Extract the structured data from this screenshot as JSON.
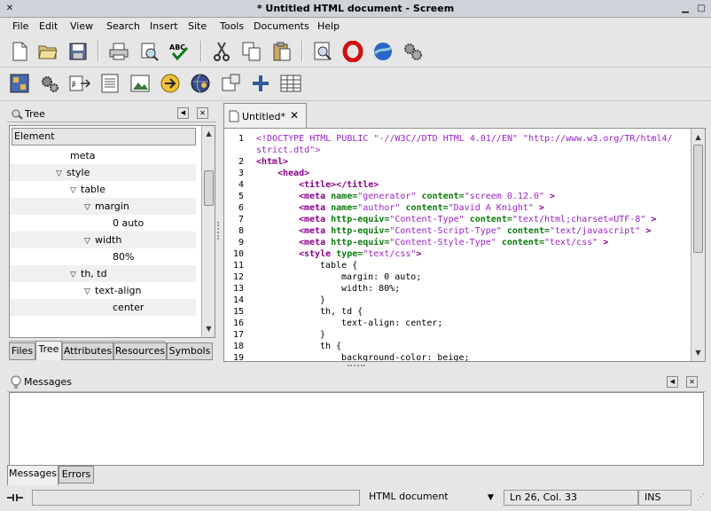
{
  "window": {
    "title": "* Untitled HTML document - Screem"
  },
  "menubar": [
    "File",
    "Edit",
    "View",
    "Search",
    "Insert",
    "Site",
    "Tools",
    "Documents",
    "Help"
  ],
  "toolbar1": [
    "new-document-icon",
    "open-folder-icon",
    "save-icon",
    "print-icon",
    "print-preview-icon",
    "spell-check-icon",
    "cut-icon",
    "copy-icon",
    "paste-icon",
    "preview-icon",
    "opera-icon",
    "mozilla-icon",
    "gears-icon"
  ],
  "toolbar2": [
    "site-icon",
    "settings-gears-icon",
    "export-icon",
    "text-icon",
    "image-icon",
    "link-arrow-icon",
    "globe-icon",
    "plugin-icon",
    "add-plus-icon",
    "table-icon"
  ],
  "tree": {
    "title": "Tree",
    "header": "Element",
    "nodes": [
      {
        "label": "meta",
        "expanded": null
      },
      {
        "label": "style",
        "expanded": true
      },
      {
        "label": "table",
        "expanded": true
      },
      {
        "label": "margin",
        "expanded": true
      },
      {
        "label": "0 auto",
        "expanded": null
      },
      {
        "label": "width",
        "expanded": true
      },
      {
        "label": "80%",
        "expanded": null
      },
      {
        "label": "th, td",
        "expanded": true
      },
      {
        "label": "text-align",
        "expanded": true
      },
      {
        "label": "center",
        "expanded": null
      }
    ],
    "tabs": [
      "Files",
      "Tree",
      "Attributes",
      "Resources",
      "Symbols"
    ],
    "active_tab": "Tree"
  },
  "editor": {
    "tab_label": "Untitled*",
    "line_numbers": [
      "1",
      "",
      "2",
      "3",
      "4",
      "5",
      "6",
      "7",
      "8",
      "9",
      "10",
      "11",
      "12",
      "13",
      "14",
      "15",
      "16",
      "17",
      "18",
      "19"
    ]
  },
  "messages": {
    "title": "Messages",
    "tabs": [
      "Messages",
      "Errors"
    ],
    "active_tab": "Messages"
  },
  "status": {
    "doc_type": "HTML document",
    "position": "Ln 26, Col. 33",
    "mode": "INS"
  },
  "colors": {
    "tag": "#8b008b",
    "attr_name": "#0b7a0b",
    "attr_value": "#9b20c8",
    "doctype": "#9b20c8"
  }
}
